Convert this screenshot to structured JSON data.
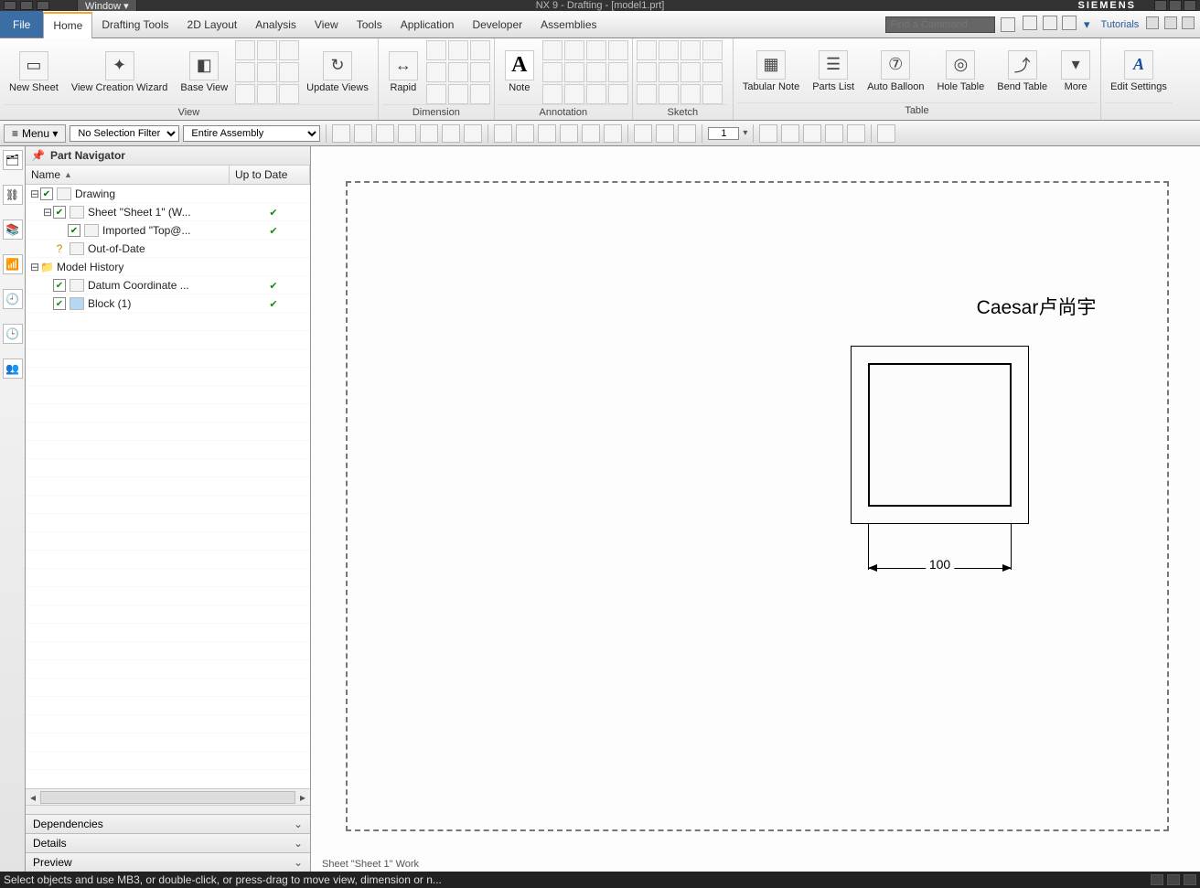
{
  "title_bar": {
    "window_menu": "Window ▾",
    "app_title": "NX 9 - Drafting - [model1.prt]",
    "brand": "SIEMENS"
  },
  "menu": {
    "file": "File",
    "tabs": [
      "Home",
      "Drafting Tools",
      "2D Layout",
      "Analysis",
      "View",
      "Tools",
      "Application",
      "Developer",
      "Assemblies"
    ],
    "search_placeholder": "Find a Command",
    "tutorials": "Tutorials"
  },
  "ribbon": {
    "groups": {
      "view": {
        "label": "View",
        "buttons": {
          "new_sheet": "New\nSheet",
          "view_wizard": "View Creation\nWizard",
          "base_view": "Base\nView",
          "update": "Update\nViews"
        }
      },
      "dimension": {
        "label": "Dimension",
        "buttons": {
          "rapid": "Rapid"
        }
      },
      "annotation": {
        "label": "Annotation",
        "buttons": {
          "note": "Note"
        }
      },
      "sketch": {
        "label": "Sketch"
      },
      "table": {
        "label": "Table",
        "buttons": {
          "tabular": "Tabular\nNote",
          "parts": "Parts\nList",
          "auto": "Auto\nBalloon",
          "hole": "Hole\nTable",
          "bend": "Bend\nTable",
          "more": "More"
        }
      },
      "edit": {
        "buttons": {
          "edit": "Edit\nSettings"
        }
      }
    }
  },
  "toolbar2": {
    "menu_label": "Menu ▾",
    "selection_filter": "No Selection Filter",
    "scope": "Entire Assembly",
    "numeric_input": "1"
  },
  "navigator": {
    "title": "Part Navigator",
    "columns": {
      "name": "Name",
      "uptodate": "Up to Date"
    },
    "tree": {
      "drawing": "Drawing",
      "sheet": "Sheet \"Sheet 1\" (W...",
      "imported": "Imported \"Top@...",
      "outofdate": "Out-of-Date",
      "model_history": "Model History",
      "datum": "Datum Coordinate ...",
      "block": "Block (1)"
    },
    "bottom_panes": [
      "Dependencies",
      "Details",
      "Preview"
    ]
  },
  "canvas": {
    "label_text": "Caesar卢尚宇",
    "dimension_value": "100",
    "sheet_status": "Sheet \"Sheet 1\" Work"
  },
  "statusbar": {
    "prompt": "Select objects and use MB3, or double-click, or press-drag to move view, dimension or n..."
  }
}
